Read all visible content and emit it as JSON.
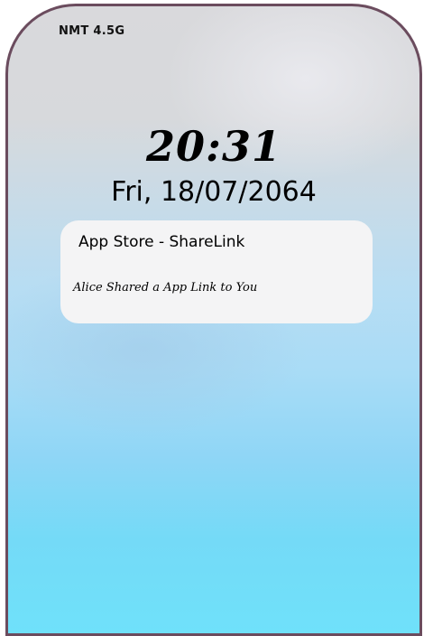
{
  "status_bar": {
    "carrier": "NMT 4.5G"
  },
  "lock_screen": {
    "time": "20:31",
    "date": "Fri, 18/07/2064"
  },
  "notification": {
    "title": "App Store - ShareLink",
    "body": "Alice Shared a App Link to You"
  },
  "colors": {
    "frame": "#6b4c5e",
    "wallpaper_top": "#d9d9dc",
    "wallpaper_bottom": "#6fe1fa",
    "notification_bg": "#f4f4f5"
  }
}
